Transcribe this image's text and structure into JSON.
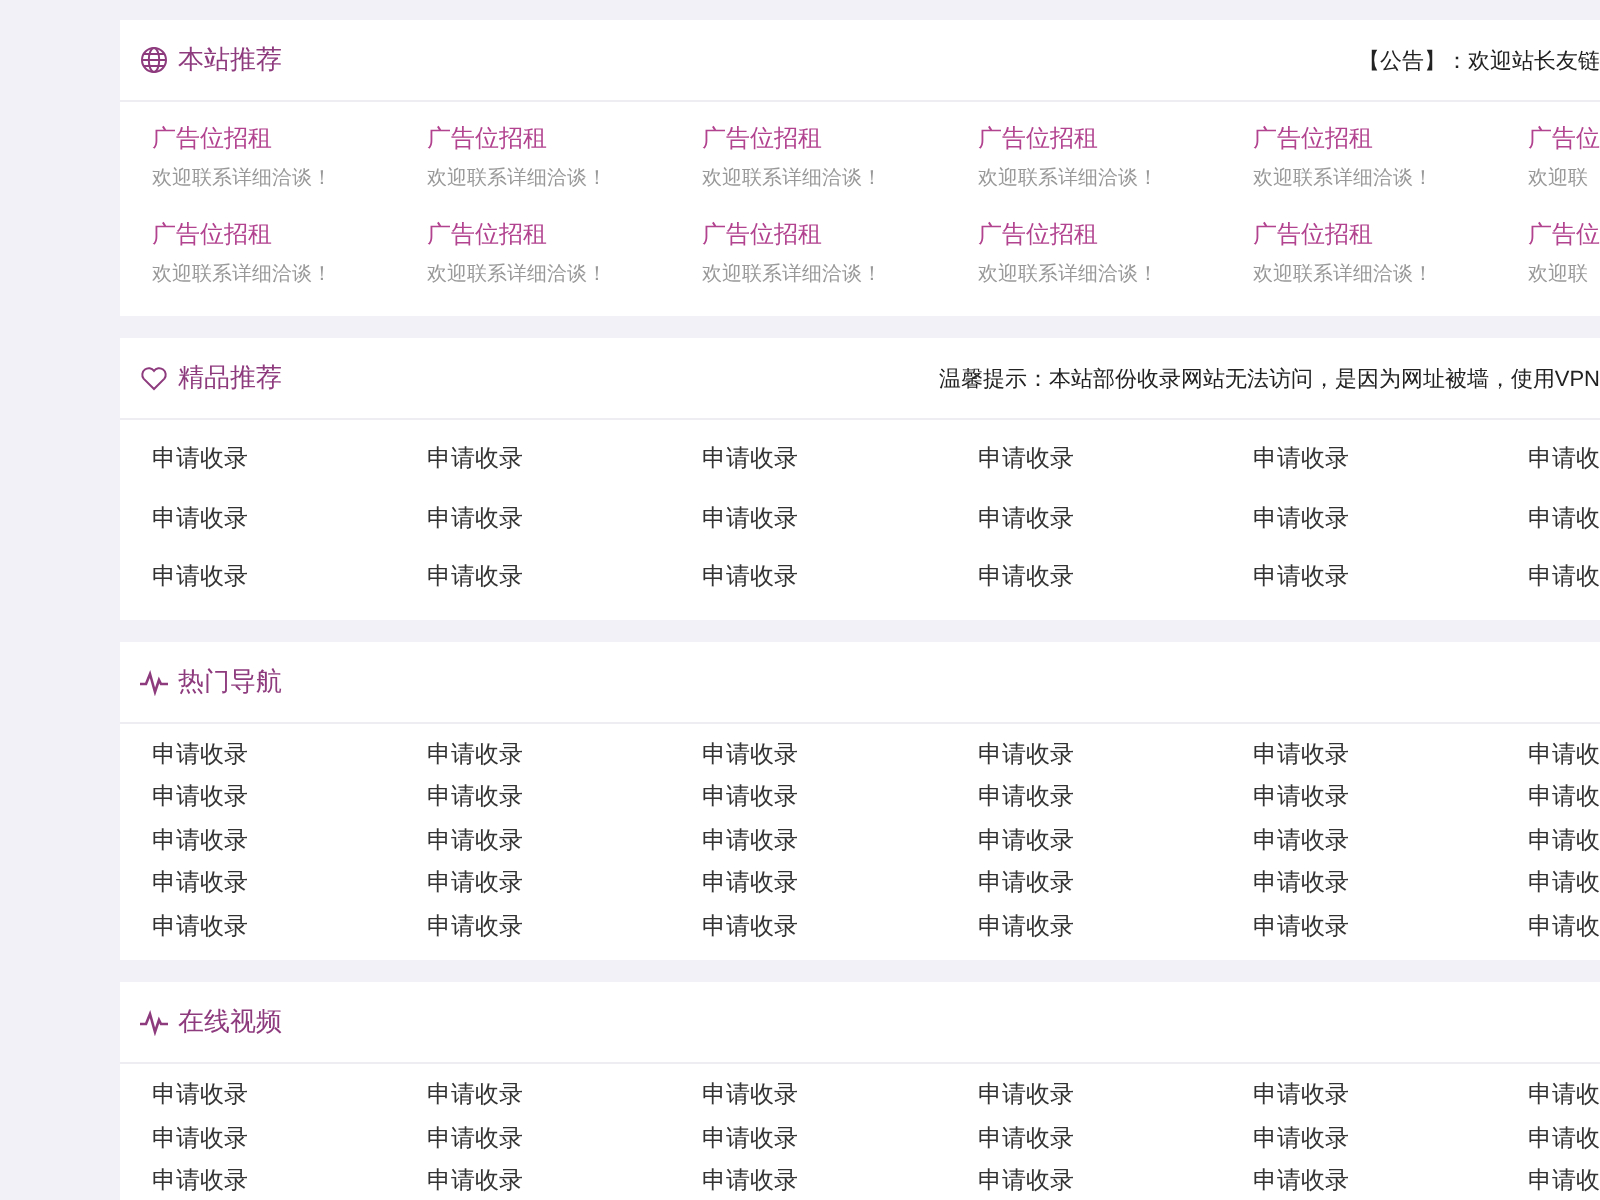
{
  "sections": [
    {
      "title": "本站推荐",
      "notice": "【公告】：欢迎站长友链",
      "kind": "ads",
      "rows": [
        [
          {
            "title": "广告位招租",
            "subtitle": "欢迎联系详细洽谈！"
          },
          {
            "title": "广告位招租",
            "subtitle": "欢迎联系详细洽谈！"
          },
          {
            "title": "广告位招租",
            "subtitle": "欢迎联系详细洽谈！"
          },
          {
            "title": "广告位招租",
            "subtitle": "欢迎联系详细洽谈！"
          },
          {
            "title": "广告位招租",
            "subtitle": "欢迎联系详细洽谈！"
          },
          {
            "title": "广告位",
            "subtitle": "欢迎联"
          }
        ],
        [
          {
            "title": "广告位招租",
            "subtitle": "欢迎联系详细洽谈！"
          },
          {
            "title": "广告位招租",
            "subtitle": "欢迎联系详细洽谈！"
          },
          {
            "title": "广告位招租",
            "subtitle": "欢迎联系详细洽谈！"
          },
          {
            "title": "广告位招租",
            "subtitle": "欢迎联系详细洽谈！"
          },
          {
            "title": "广告位招租",
            "subtitle": "欢迎联系详细洽谈！"
          },
          {
            "title": "广告位",
            "subtitle": "欢迎联"
          }
        ]
      ]
    },
    {
      "title": "精品推荐",
      "notice": "温馨提示：本站部份收录网站无法访问，是因为网址被墙，使用VPN",
      "kind": "links",
      "rows": [
        [
          "申请收录",
          "申请收录",
          "申请收录",
          "申请收录",
          "申请收录",
          "申请收"
        ],
        [
          "申请收录",
          "申请收录",
          "申请收录",
          "申请收录",
          "申请收录",
          "申请收"
        ],
        [
          "申请收录",
          "申请收录",
          "申请收录",
          "申请收录",
          "申请收录",
          "申请收"
        ]
      ]
    },
    {
      "title": "热门导航",
      "kind": "links",
      "rows": [
        [
          "申请收录",
          "申请收录",
          "申请收录",
          "申请收录",
          "申请收录",
          "申请收"
        ],
        [
          "申请收录",
          "申请收录",
          "申请收录",
          "申请收录",
          "申请收录",
          "申请收"
        ],
        [
          "申请收录",
          "申请收录",
          "申请收录",
          "申请收录",
          "申请收录",
          "申请收"
        ],
        [
          "申请收录",
          "申请收录",
          "申请收录",
          "申请收录",
          "申请收录",
          "申请收"
        ],
        [
          "申请收录",
          "申请收录",
          "申请收录",
          "申请收录",
          "申请收录",
          "申请收"
        ]
      ]
    },
    {
      "title": "在线视频",
      "kind": "links",
      "rows": [
        [
          "申请收录",
          "申请收录",
          "申请收录",
          "申请收录",
          "申请收录",
          "申请收"
        ],
        [
          "申请收录",
          "申请收录",
          "申请收录",
          "申请收录",
          "申请收录",
          "申请收"
        ],
        [
          "申请收录",
          "申请收录",
          "申请收录",
          "申请收录",
          "申请收录",
          "申请收"
        ]
      ]
    }
  ]
}
